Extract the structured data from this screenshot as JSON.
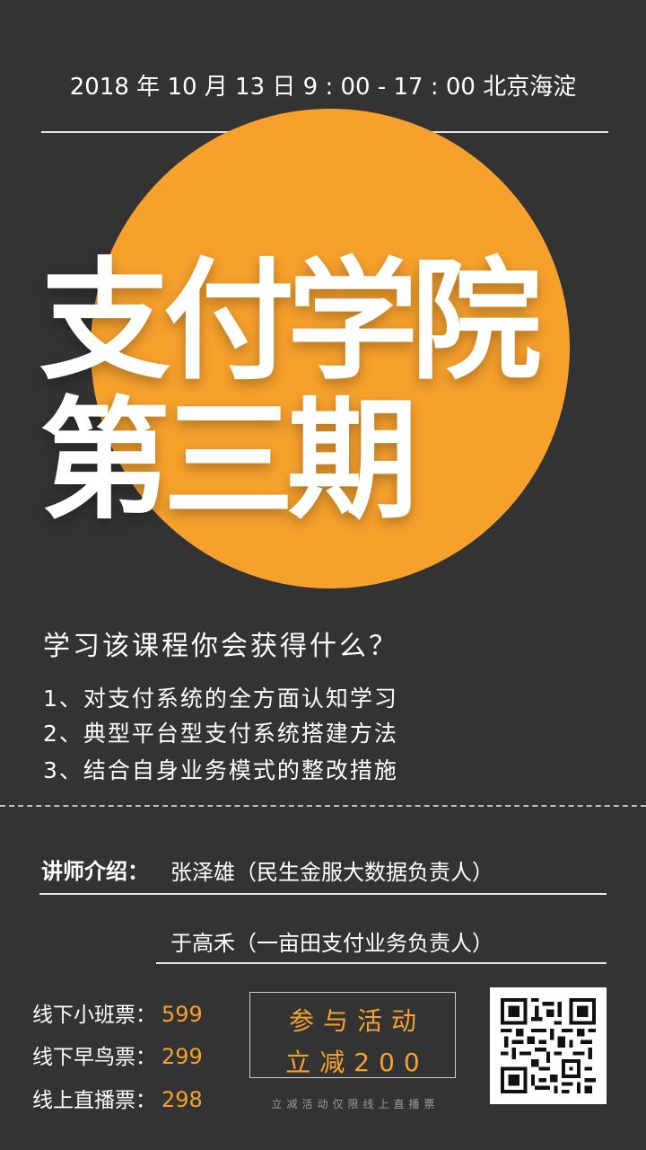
{
  "event": {
    "datetime_location": "2018 年 10 月 13 日 9 : 00 - 17 : 00  北京海淀",
    "title_line1": "支付学院",
    "title_line2": "第三期"
  },
  "benefits": {
    "question": "学习该课程你会获得什么？",
    "items": [
      "1、对支付系统的全方面认知学习",
      "2、典型平台型支付系统搭建方法",
      "3、结合自身业务模式的整改措施"
    ]
  },
  "lecturers": {
    "label": "讲师介绍：",
    "names": [
      "张泽雄（民生金服大数据负责人）",
      "于高禾（一亩田支付业务负责人）"
    ]
  },
  "tickets": [
    {
      "label": "线下小班票：",
      "price": "599"
    },
    {
      "label": "线下早鸟票：",
      "price": "299"
    },
    {
      "label": "线上直播票：",
      "price": "298"
    }
  ],
  "promo": {
    "line1": "参与活动",
    "line2": "立减200",
    "note": "立减活动仅限线上直播票"
  },
  "colors": {
    "background": "#333333",
    "accent": "#f7a12d",
    "text": "#ffffff"
  },
  "icons": {
    "qr_code": "qr-code-icon"
  }
}
